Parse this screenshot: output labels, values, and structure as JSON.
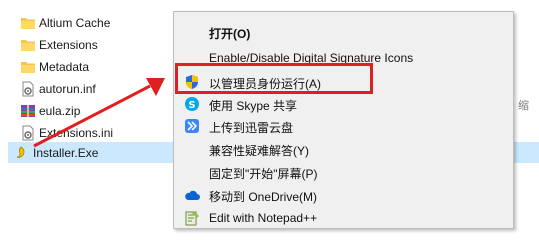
{
  "files": [
    {
      "name": "Altium Cache",
      "icon": "folder-icon"
    },
    {
      "name": "Extensions",
      "icon": "folder-icon"
    },
    {
      "name": "Metadata",
      "icon": "folder-icon"
    },
    {
      "name": "autorun.inf",
      "icon": "settings-file-icon"
    },
    {
      "name": "eula.zip",
      "icon": "zip-icon"
    },
    {
      "name": "Extensions.ini",
      "icon": "settings-file-icon"
    },
    {
      "name": "Installer.Exe",
      "icon": "installer-icon"
    }
  ],
  "background_fragment": "缩",
  "context_menu": {
    "items": [
      {
        "label": "打开(O)",
        "icon": ""
      },
      {
        "label": "Enable/Disable Digital Signature Icons",
        "icon": ""
      },
      {
        "label": "以管理员身份运行(A)",
        "icon": "uac-shield-icon"
      },
      {
        "label": "使用 Skype 共享",
        "icon": "skype-icon"
      },
      {
        "label": "上传到迅雷云盘",
        "icon": "xunlei-icon"
      },
      {
        "label": "兼容性疑难解答(Y)",
        "icon": ""
      },
      {
        "label": "固定到\"开始\"屏幕(P)",
        "icon": ""
      },
      {
        "label": "移动到 OneDrive(M)",
        "icon": "onedrive-icon"
      },
      {
        "label": "Edit with Notepad++",
        "icon": "notepadpp-icon"
      }
    ]
  },
  "colors": {
    "highlight_box": "#e02020",
    "selected_row": "#cce8ff",
    "menu_background": "#f0f0f0"
  }
}
